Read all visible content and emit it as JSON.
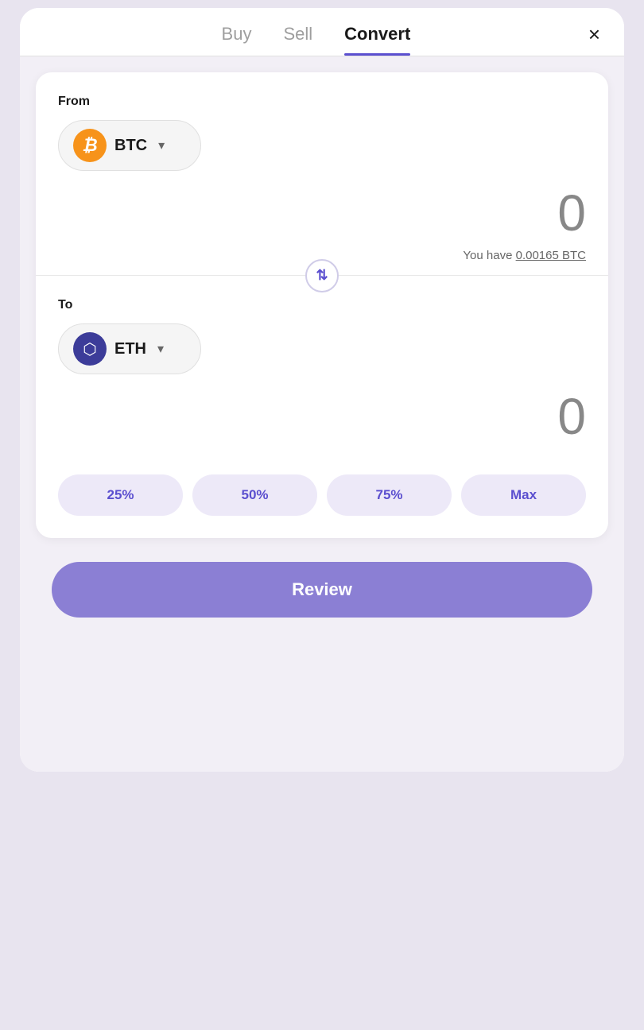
{
  "tabs": {
    "buy": {
      "label": "Buy",
      "active": false
    },
    "sell": {
      "label": "Sell",
      "active": false
    },
    "convert": {
      "label": "Convert",
      "active": true
    }
  },
  "close": {
    "label": "×"
  },
  "from_section": {
    "label": "From",
    "currency": "BTC",
    "amount": "0",
    "balance_text": "You have",
    "balance_amount": "0.00165 BTC"
  },
  "to_section": {
    "label": "To",
    "currency": "ETH",
    "amount": "0"
  },
  "pct_buttons": [
    {
      "label": "25%"
    },
    {
      "label": "50%"
    },
    {
      "label": "75%"
    },
    {
      "label": "Max"
    }
  ],
  "review_button": {
    "label": "Review"
  },
  "colors": {
    "accent": "#5b4fcf",
    "btc_orange": "#f7931a",
    "eth_blue": "#3c3c99",
    "review_btn": "#8b7fd4"
  }
}
